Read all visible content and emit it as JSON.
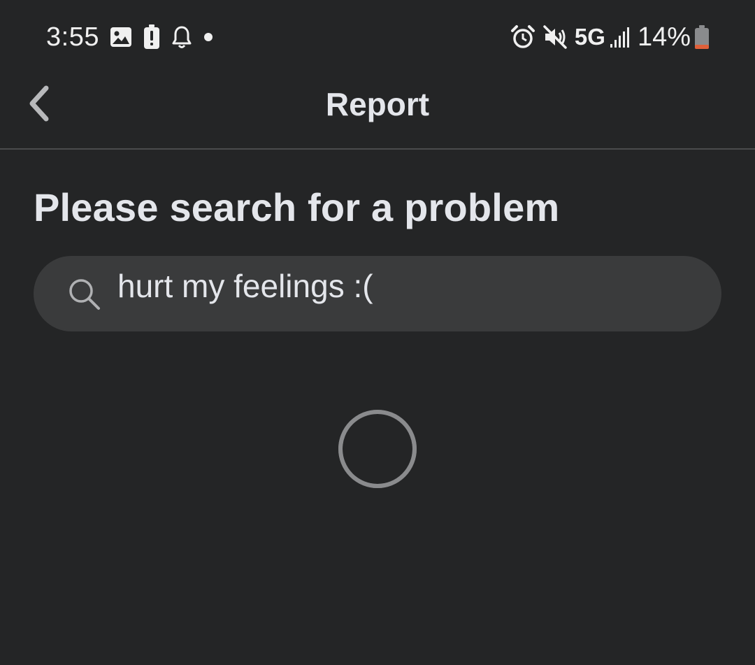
{
  "status_bar": {
    "time": "3:55",
    "network": "5G",
    "battery": "14%",
    "left_icons": [
      "image-icon",
      "battery-alert-icon",
      "bell-icon",
      "dot-icon"
    ],
    "right_icons": [
      "alarm-icon",
      "mute-icon",
      "signal-icon",
      "battery-icon"
    ]
  },
  "header": {
    "title": "Report",
    "back_icon": "chevron-left-icon"
  },
  "main": {
    "heading": "Please search for a problem",
    "search": {
      "value": "hurt my feelings :(",
      "icon": "search-icon"
    },
    "loading": true
  },
  "colors": {
    "background": "#242526",
    "surface": "#3a3b3c",
    "text": "#e4e6eb",
    "spinner": "#8a8b8d",
    "battery_low": "#e0603a"
  }
}
